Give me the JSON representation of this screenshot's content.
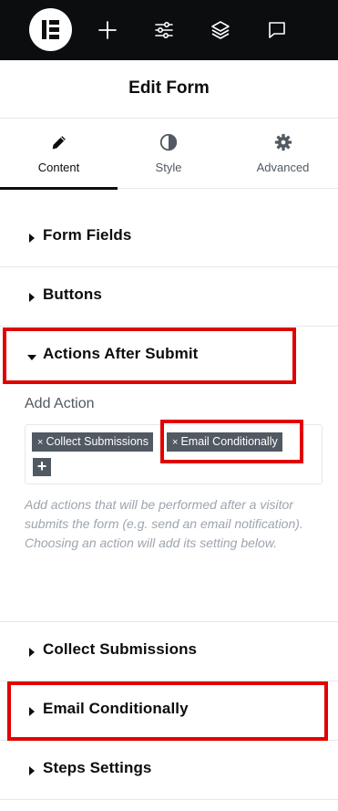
{
  "toolbar": {
    "logo_icon": "elementor-logo-icon",
    "add_icon": "plus-icon",
    "settings_icon": "sliders-icon",
    "structure_icon": "layers-icon",
    "notes_icon": "comment-icon"
  },
  "header": {
    "title": "Edit Form"
  },
  "tabs": [
    {
      "label": "Content",
      "icon": "pencil-icon",
      "active": true
    },
    {
      "label": "Style",
      "icon": "contrast-icon",
      "active": false
    },
    {
      "label": "Advanced",
      "icon": "gear-icon",
      "active": false
    }
  ],
  "sections": {
    "form_fields": "Form Fields",
    "buttons": "Buttons",
    "actions_after_submit": "Actions After Submit",
    "collect_submissions": "Collect Submissions",
    "email_conditionally": "Email Conditionally",
    "steps_settings": "Steps Settings"
  },
  "actions_panel": {
    "add_action_label": "Add Action",
    "tags": [
      {
        "remove": "×",
        "label": "Collect Submissions"
      },
      {
        "remove": "×",
        "label": "Email Conditionally"
      }
    ],
    "add_button": "+",
    "help_text": "Add actions that will be performed after a visitor submits the form (e.g. send an email notification). Choosing an action will add its setting below."
  },
  "colors": {
    "topbar": "#0c0d0e",
    "tag": "#515962",
    "highlight": "#e10000",
    "help_text": "#9da5ae"
  }
}
